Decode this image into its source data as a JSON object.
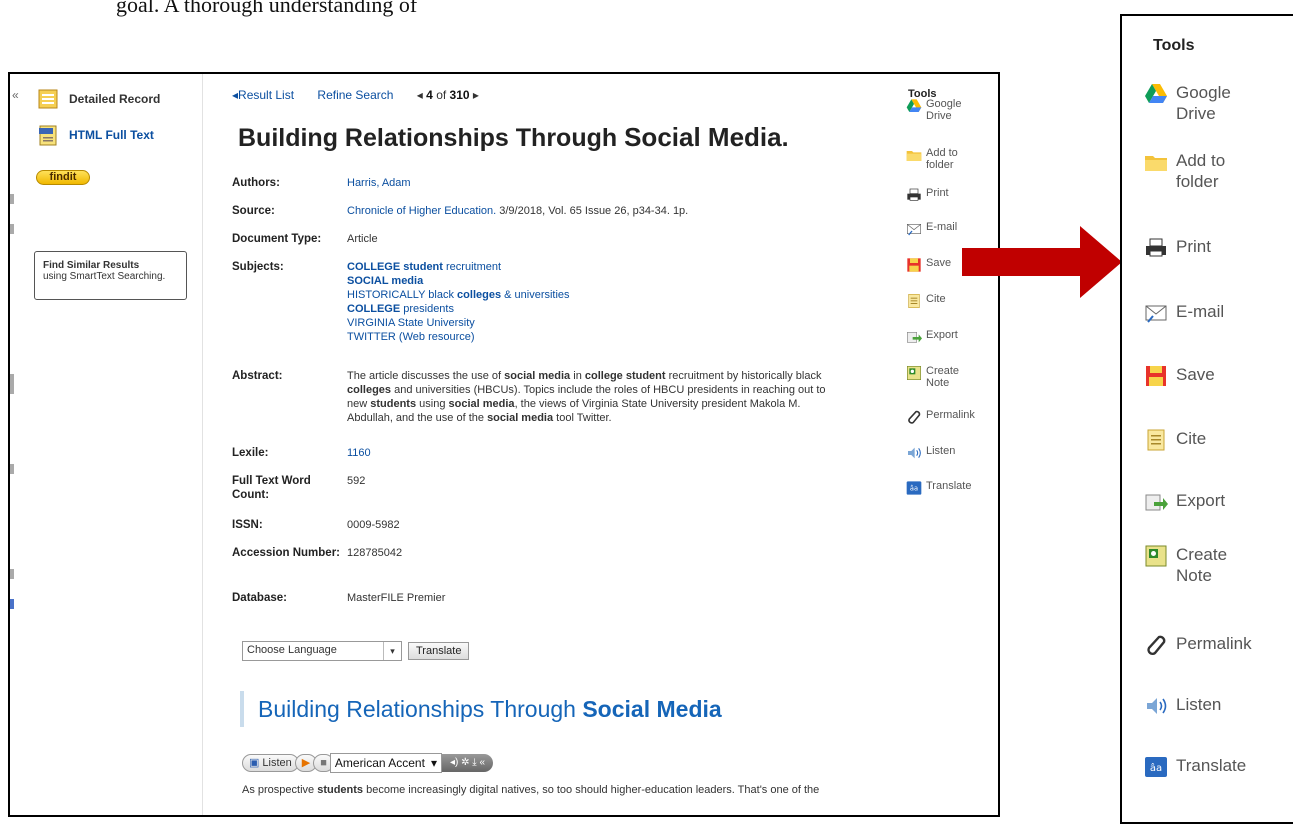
{
  "top_text": "goal. A thorough understanding of",
  "left_panel": {
    "collapse": "«",
    "detailed_record": "Detailed Record",
    "html_full_text": "HTML Full Text",
    "findit": "findit",
    "similar_title": "Find Similar Results",
    "similar_sub": "using SmartText Searching."
  },
  "nav": {
    "result_list": "Result List",
    "refine_search": "Refine Search",
    "index": "4",
    "of": "of",
    "total": "310"
  },
  "record": {
    "title": "Building Relationships Through",
    "title_emph": "Social Media",
    "title_end": ".",
    "authors_label": "Authors:",
    "authors": "Harris, Adam",
    "source_label": "Source:",
    "source_link": "Chronicle of Higher Education.",
    "source_rest": " 3/9/2018, Vol. 65 Issue 26, p34-34. 1p.",
    "doctype_label": "Document Type:",
    "doctype": "Article",
    "subjects_label": "Subjects:",
    "subjects": [
      {
        "bold": "COLLEGE student",
        "rest": " recruitment"
      },
      {
        "bold": "SOCIAL media",
        "rest": ""
      },
      {
        "bold": "",
        "rest": "HISTORICALLY black ",
        "bold2": "colleges",
        "rest2": " & universities"
      },
      {
        "bold": "COLLEGE",
        "rest": " presidents"
      },
      {
        "bold": "",
        "rest": "VIRGINIA State University"
      },
      {
        "bold": "",
        "rest": "TWITTER (Web resource)"
      }
    ],
    "abstract_label": "Abstract:",
    "abstract_lines": [
      [
        "The article discusses the use of ",
        "social media",
        " in ",
        "college student",
        " recruitment by historically black"
      ],
      [
        "",
        "colleges",
        " and universities (HBCUs). Topics include the roles of HBCU presidents in reaching out to"
      ],
      [
        "new ",
        "students",
        " using ",
        "social media",
        ", the views of Virginia State University president Makola M."
      ],
      [
        "Abdullah, and the use of the ",
        "social media",
        " tool Twitter."
      ]
    ],
    "lexile_label": "Lexile:",
    "lexile": "1160",
    "wordcount_label": "Full Text Word Count:",
    "wordcount": "592",
    "issn_label": "ISSN:",
    "issn": "0009-5982",
    "accession_label": "Accession Number:",
    "accession": "128785042",
    "database_label": "Database:",
    "database": "MasterFILE Premier"
  },
  "translate": {
    "select": "Choose Language",
    "button": "Translate"
  },
  "body": {
    "title": "Building Relationships Through",
    "title_emph": "Social Media",
    "player_listen": "Listen",
    "accent": "American Accent",
    "text_a": "As prospective ",
    "text_b": "students",
    "text_c": " become increasingly digital natives, so too should higher-education leaders. That's one of the"
  },
  "tools": {
    "heading": "Tools",
    "items": [
      {
        "l1": "Google",
        "l2": "Drive",
        "icon": "google-drive-icon"
      },
      {
        "l1": "Add to",
        "l2": "folder",
        "icon": "folder-icon"
      },
      {
        "l1": "Print",
        "l2": "",
        "icon": "printer-icon"
      },
      {
        "l1": "E-mail",
        "l2": "",
        "icon": "email-icon"
      },
      {
        "l1": "Save",
        "l2": "",
        "icon": "save-icon"
      },
      {
        "l1": "Cite",
        "l2": "",
        "icon": "cite-icon"
      },
      {
        "l1": "Export",
        "l2": "",
        "icon": "export-icon"
      },
      {
        "l1": "Create",
        "l2": "Note",
        "icon": "note-icon"
      },
      {
        "l1": "Permalink",
        "l2": "",
        "icon": "link-icon"
      },
      {
        "l1": "Listen",
        "l2": "",
        "icon": "speaker-icon"
      },
      {
        "l1": "Translate",
        "l2": "",
        "icon": "translate-icon"
      }
    ]
  },
  "colors": {
    "link": "#0b4fa0",
    "arrow": "#c00000"
  }
}
